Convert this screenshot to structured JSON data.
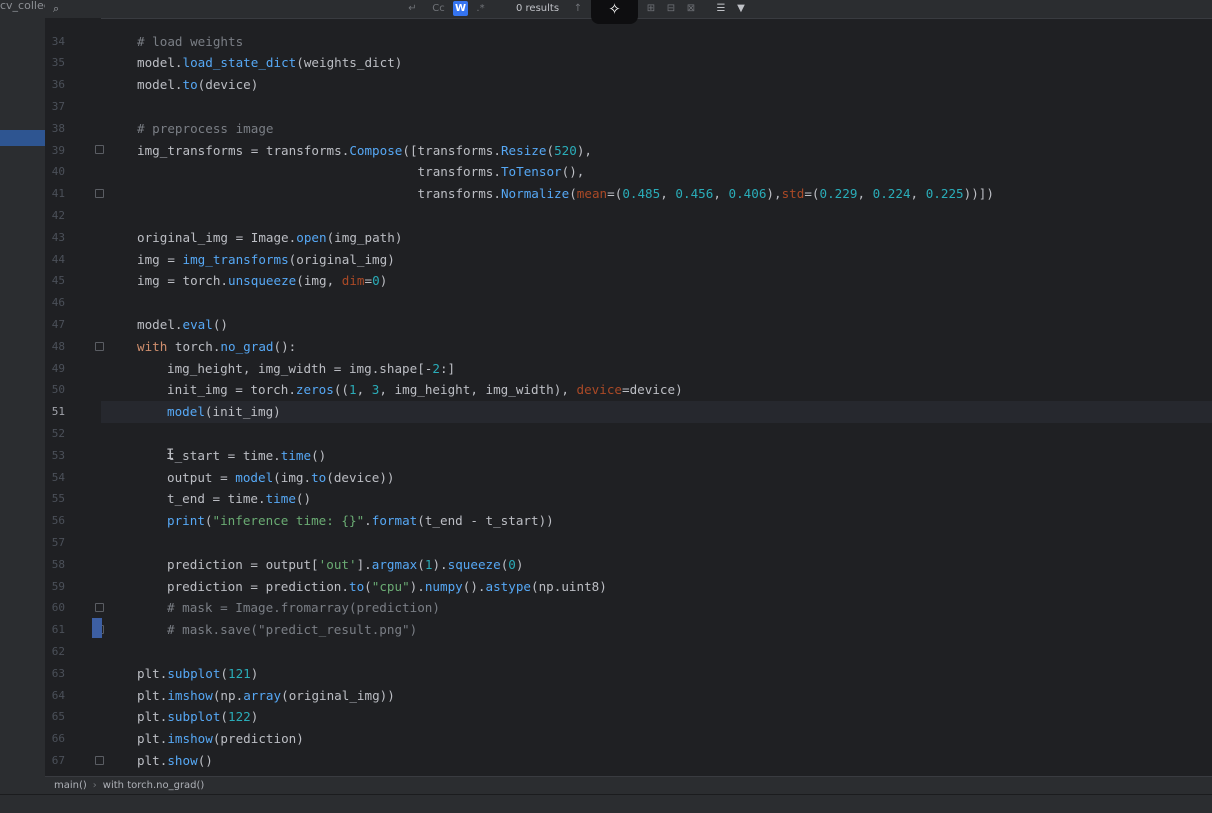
{
  "project_label": "cv_collec",
  "search": {
    "icon": "search-icon",
    "results": "0 results",
    "match_case": "Cc",
    "words": "W",
    "regex": ".*"
  },
  "lines": [
    {
      "n": "34",
      "s": [
        {
          "c": "cm",
          "t": "# load weights"
        }
      ],
      "i": 1
    },
    {
      "n": "35",
      "s": [
        {
          "c": "pl",
          "t": "model."
        },
        {
          "c": "fn",
          "t": "load_state_dict"
        },
        {
          "c": "pl",
          "t": "(weights_dict)"
        }
      ],
      "i": 1
    },
    {
      "n": "36",
      "s": [
        {
          "c": "pl",
          "t": "model."
        },
        {
          "c": "fn",
          "t": "to"
        },
        {
          "c": "pl",
          "t": "(device)"
        }
      ],
      "i": 1
    },
    {
      "n": "37",
      "s": [],
      "i": 1
    },
    {
      "n": "38",
      "s": [
        {
          "c": "cm",
          "t": "# preprocess image"
        }
      ],
      "i": 1
    },
    {
      "n": "39",
      "s": [
        {
          "c": "pl",
          "t": "img_transforms = transforms."
        },
        {
          "c": "fn",
          "t": "Compose"
        },
        {
          "c": "pl",
          "t": "([transforms."
        },
        {
          "c": "fn",
          "t": "Resize"
        },
        {
          "c": "pl",
          "t": "("
        },
        {
          "c": "num",
          "t": "520"
        },
        {
          "c": "pl",
          "t": "),"
        }
      ],
      "i": 1
    },
    {
      "n": "40",
      "s": [
        {
          "c": "pl",
          "t": "                                     transforms."
        },
        {
          "c": "fn",
          "t": "ToTensor"
        },
        {
          "c": "pl",
          "t": "(),"
        }
      ],
      "i": 1
    },
    {
      "n": "41",
      "s": [
        {
          "c": "pl",
          "t": "                                     transforms."
        },
        {
          "c": "fn",
          "t": "Normalize"
        },
        {
          "c": "pl",
          "t": "("
        },
        {
          "c": "kwarg",
          "t": "mean"
        },
        {
          "c": "pl",
          "t": "=("
        },
        {
          "c": "num",
          "t": "0.485"
        },
        {
          "c": "pl",
          "t": ", "
        },
        {
          "c": "num",
          "t": "0.456"
        },
        {
          "c": "pl",
          "t": ", "
        },
        {
          "c": "num",
          "t": "0.406"
        },
        {
          "c": "pl",
          "t": "),"
        },
        {
          "c": "kwarg",
          "t": "std"
        },
        {
          "c": "pl",
          "t": "=("
        },
        {
          "c": "num",
          "t": "0.229"
        },
        {
          "c": "pl",
          "t": ", "
        },
        {
          "c": "num",
          "t": "0.224"
        },
        {
          "c": "pl",
          "t": ", "
        },
        {
          "c": "num",
          "t": "0.225"
        },
        {
          "c": "pl",
          "t": "))])"
        }
      ],
      "i": 1
    },
    {
      "n": "42",
      "s": [],
      "i": 1
    },
    {
      "n": "43",
      "s": [
        {
          "c": "pl",
          "t": "original_img = Image."
        },
        {
          "c": "fn",
          "t": "open"
        },
        {
          "c": "pl",
          "t": "(img_path)"
        }
      ],
      "i": 1
    },
    {
      "n": "44",
      "s": [
        {
          "c": "pl",
          "t": "img = "
        },
        {
          "c": "fn",
          "t": "img_transforms"
        },
        {
          "c": "pl",
          "t": "(original_img)"
        }
      ],
      "i": 1
    },
    {
      "n": "45",
      "s": [
        {
          "c": "pl",
          "t": "img = torch."
        },
        {
          "c": "fn",
          "t": "unsqueeze"
        },
        {
          "c": "pl",
          "t": "(img, "
        },
        {
          "c": "kwarg",
          "t": "dim"
        },
        {
          "c": "pl",
          "t": "="
        },
        {
          "c": "num",
          "t": "0"
        },
        {
          "c": "pl",
          "t": ")"
        }
      ],
      "i": 1
    },
    {
      "n": "46",
      "s": [],
      "i": 1
    },
    {
      "n": "47",
      "s": [
        {
          "c": "pl",
          "t": "model."
        },
        {
          "c": "fn",
          "t": "eval"
        },
        {
          "c": "pl",
          "t": "()"
        }
      ],
      "i": 1
    },
    {
      "n": "48",
      "s": [
        {
          "c": "kw",
          "t": "with"
        },
        {
          "c": "pl",
          "t": " torch."
        },
        {
          "c": "fn",
          "t": "no_grad"
        },
        {
          "c": "pl",
          "t": "():"
        }
      ],
      "i": 1
    },
    {
      "n": "49",
      "s": [
        {
          "c": "pl",
          "t": "img_height, img_width = img.shape[-"
        },
        {
          "c": "num",
          "t": "2"
        },
        {
          "c": "pl",
          "t": ":]"
        }
      ],
      "i": 2
    },
    {
      "n": "50",
      "s": [
        {
          "c": "pl",
          "t": "init_img = torch."
        },
        {
          "c": "fn",
          "t": "zeros"
        },
        {
          "c": "pl",
          "t": "(("
        },
        {
          "c": "num",
          "t": "1"
        },
        {
          "c": "pl",
          "t": ", "
        },
        {
          "c": "num",
          "t": "3"
        },
        {
          "c": "pl",
          "t": ", img_height, img_width), "
        },
        {
          "c": "kwarg",
          "t": "device"
        },
        {
          "c": "pl",
          "t": "=device)"
        }
      ],
      "i": 2
    },
    {
      "n": "51",
      "s": [
        {
          "c": "fn",
          "t": "model"
        },
        {
          "c": "pl",
          "t": "(init_img)"
        }
      ],
      "i": 2
    },
    {
      "n": "52",
      "s": [],
      "i": 2
    },
    {
      "n": "53",
      "s": [
        {
          "c": "pl",
          "t": "t_start = time."
        },
        {
          "c": "fn",
          "t": "time"
        },
        {
          "c": "pl",
          "t": "()"
        }
      ],
      "i": 2
    },
    {
      "n": "54",
      "s": [
        {
          "c": "pl",
          "t": "output = "
        },
        {
          "c": "fn",
          "t": "model"
        },
        {
          "c": "pl",
          "t": "(img."
        },
        {
          "c": "fn",
          "t": "to"
        },
        {
          "c": "pl",
          "t": "(device))"
        }
      ],
      "i": 2
    },
    {
      "n": "55",
      "s": [
        {
          "c": "pl",
          "t": "t_end = time."
        },
        {
          "c": "fn",
          "t": "time"
        },
        {
          "c": "pl",
          "t": "()"
        }
      ],
      "i": 2
    },
    {
      "n": "56",
      "s": [
        {
          "c": "fn",
          "t": "print"
        },
        {
          "c": "pl",
          "t": "("
        },
        {
          "c": "str",
          "t": "\"inference time: {}\""
        },
        {
          "c": "pl",
          "t": "."
        },
        {
          "c": "fn",
          "t": "format"
        },
        {
          "c": "pl",
          "t": "(t_end - t_start))"
        }
      ],
      "i": 2
    },
    {
      "n": "57",
      "s": [],
      "i": 2
    },
    {
      "n": "58",
      "s": [
        {
          "c": "pl",
          "t": "prediction = output["
        },
        {
          "c": "str",
          "t": "'out'"
        },
        {
          "c": "pl",
          "t": "]."
        },
        {
          "c": "fn",
          "t": "argmax"
        },
        {
          "c": "pl",
          "t": "("
        },
        {
          "c": "num",
          "t": "1"
        },
        {
          "c": "pl",
          "t": ")."
        },
        {
          "c": "fn",
          "t": "squeeze"
        },
        {
          "c": "pl",
          "t": "("
        },
        {
          "c": "num",
          "t": "0"
        },
        {
          "c": "pl",
          "t": ")"
        }
      ],
      "i": 2
    },
    {
      "n": "59",
      "s": [
        {
          "c": "pl",
          "t": "prediction = prediction."
        },
        {
          "c": "fn",
          "t": "to"
        },
        {
          "c": "pl",
          "t": "("
        },
        {
          "c": "str",
          "t": "\"cpu\""
        },
        {
          "c": "pl",
          "t": ")."
        },
        {
          "c": "fn",
          "t": "numpy"
        },
        {
          "c": "pl",
          "t": "()."
        },
        {
          "c": "fn",
          "t": "astype"
        },
        {
          "c": "pl",
          "t": "(np.uint8)"
        }
      ],
      "i": 2
    },
    {
      "n": "60",
      "s": [
        {
          "c": "cm",
          "t": "# mask = Image.fromarray(prediction)"
        }
      ],
      "i": 2
    },
    {
      "n": "61",
      "s": [
        {
          "c": "cm",
          "t": "# mask.save(\"predict_result.png\")"
        }
      ],
      "i": 2
    },
    {
      "n": "62",
      "s": [],
      "i": 1
    },
    {
      "n": "63",
      "s": [
        {
          "c": "pl",
          "t": "plt."
        },
        {
          "c": "fn",
          "t": "subplot"
        },
        {
          "c": "pl",
          "t": "("
        },
        {
          "c": "num",
          "t": "121"
        },
        {
          "c": "pl",
          "t": ")"
        }
      ],
      "i": 1
    },
    {
      "n": "64",
      "s": [
        {
          "c": "pl",
          "t": "plt."
        },
        {
          "c": "fn",
          "t": "imshow"
        },
        {
          "c": "pl",
          "t": "(np."
        },
        {
          "c": "fn",
          "t": "array"
        },
        {
          "c": "pl",
          "t": "(original_img))"
        }
      ],
      "i": 1
    },
    {
      "n": "65",
      "s": [
        {
          "c": "pl",
          "t": "plt."
        },
        {
          "c": "fn",
          "t": "subplot"
        },
        {
          "c": "pl",
          "t": "("
        },
        {
          "c": "num",
          "t": "122"
        },
        {
          "c": "pl",
          "t": ")"
        }
      ],
      "i": 1
    },
    {
      "n": "66",
      "s": [
        {
          "c": "pl",
          "t": "plt."
        },
        {
          "c": "fn",
          "t": "imshow"
        },
        {
          "c": "pl",
          "t": "(prediction)"
        }
      ],
      "i": 1
    },
    {
      "n": "67",
      "s": [
        {
          "c": "pl",
          "t": "plt."
        },
        {
          "c": "fn",
          "t": "show"
        },
        {
          "c": "pl",
          "t": "()"
        }
      ],
      "i": 1
    }
  ],
  "current_line": "51",
  "breadcrumb": {
    "item1": "main()",
    "sep": "›",
    "item2": "with torch.no_grad()"
  }
}
